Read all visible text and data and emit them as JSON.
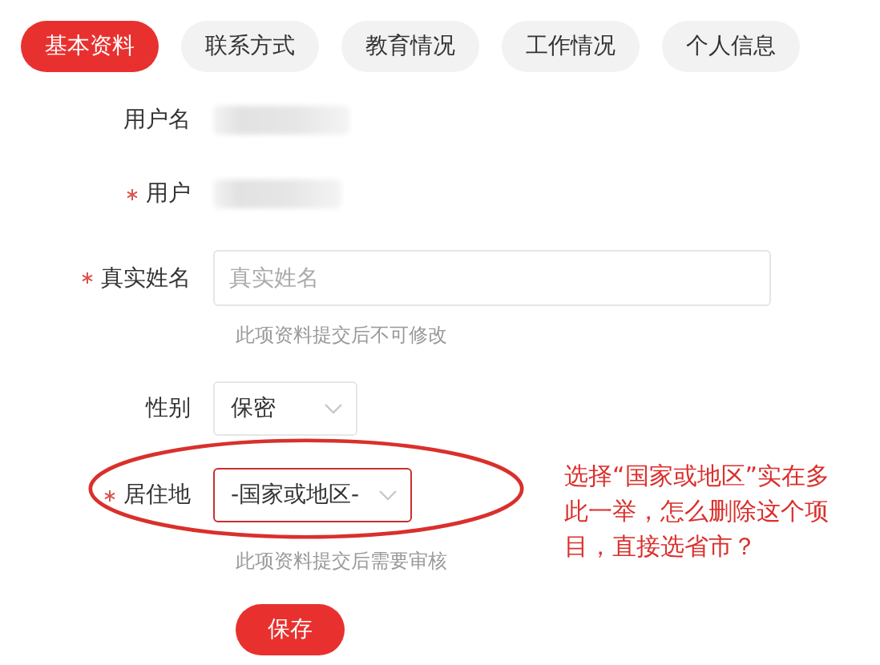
{
  "tabs": [
    {
      "label": "基本资料",
      "selected": true
    },
    {
      "label": "联系方式",
      "selected": false
    },
    {
      "label": "教育情况",
      "selected": false
    },
    {
      "label": "工作情况",
      "selected": false
    },
    {
      "label": "个人信息",
      "selected": false
    }
  ],
  "form": {
    "rows": [
      {
        "kind": "blurred",
        "label": "用户名",
        "required": false
      },
      {
        "kind": "blurred",
        "label": "用户",
        "required": true
      },
      {
        "kind": "input",
        "label": "真实姓名",
        "required": true,
        "placeholder": "真实姓名",
        "hint": "此项资料提交后不可修改"
      },
      {
        "kind": "select",
        "label": "性别",
        "required": false,
        "value": "保密",
        "focused": false
      },
      {
        "kind": "select",
        "label": "居住地",
        "required": true,
        "value": "-国家或地区-",
        "focused": true,
        "hint": "此项资料提交后需要审核"
      }
    ],
    "submit": "保存"
  },
  "annotation": {
    "text": "选择“国家或地区”实在多此一举，怎么删除这个项目，直接选省市？"
  }
}
